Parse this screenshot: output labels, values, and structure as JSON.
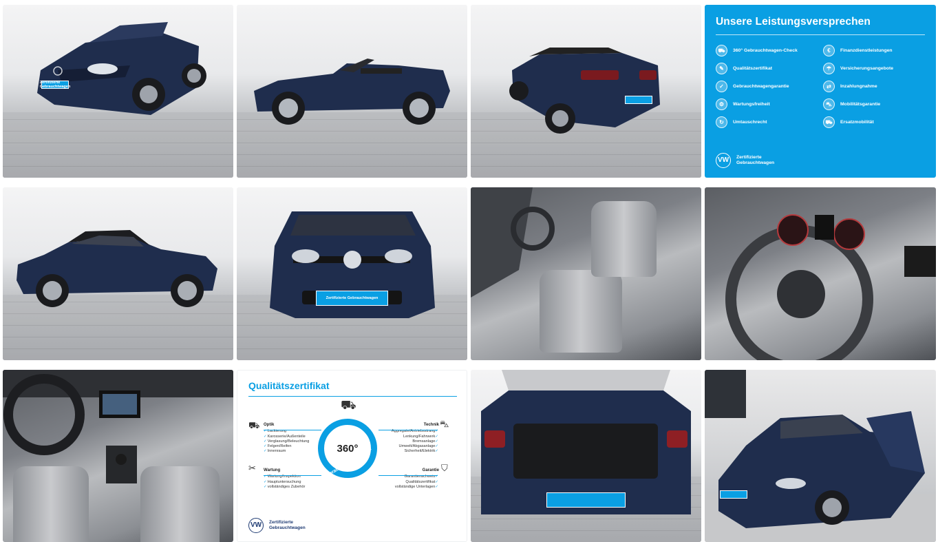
{
  "gallery": {
    "photos": [
      {
        "view": "front-left exterior, convertible top open",
        "plate": "Zertifizierte Gebrauchtwagen"
      },
      {
        "view": "side profile, top open"
      },
      {
        "view": "rear-right exterior, top open"
      },
      {
        "view": "side profile, top closed"
      },
      {
        "view": "front exterior",
        "plate": "Zertifizierte Gebrauchtwagen"
      },
      {
        "view": "interior front seats"
      },
      {
        "view": "steering wheel and cluster"
      },
      {
        "view": "dashboard and center console"
      },
      {
        "view": "open trunk"
      },
      {
        "view": "showroom front-left, door open"
      }
    ]
  },
  "promise_panel": {
    "title": "Unsere Leistungsversprechen",
    "items": [
      {
        "label": "360° Gebrauchtwagen-Check",
        "icon": "car-check-icon"
      },
      {
        "label": "Finanzdienstleistungen",
        "icon": "finance-icon"
      },
      {
        "label": "Qualitätszertifikat",
        "icon": "certificate-icon"
      },
      {
        "label": "Versicherungsangebote",
        "icon": "insurance-icon"
      },
      {
        "label": "Gebrauchtwagengarantie",
        "icon": "warranty-icon"
      },
      {
        "label": "Inzahlungnahme",
        "icon": "trade-in-icon"
      },
      {
        "label": "Wartungsfreiheit",
        "icon": "maintenance-icon"
      },
      {
        "label": "Mobilitätsgarantie",
        "icon": "mobility-icon"
      },
      {
        "label": "Umtauschrecht",
        "icon": "exchange-icon"
      },
      {
        "label": "Ersatzmobilität",
        "icon": "replacement-car-icon"
      }
    ],
    "footer": {
      "line1": "Zertifizierte",
      "line2": "Gebrauchtwagen",
      "logo": "VW"
    },
    "bg_color": "#0a9fe3"
  },
  "quality_panel": {
    "title": "Qualitätszertifikat",
    "center_number": "360°",
    "center_label": "Gebrauchtwagen-Check",
    "optik": {
      "head": "Optik",
      "items": [
        "Lackierung",
        "Karosserie/Außenteile",
        "Verglasung/Beleuchtung",
        "Felgen/Reifen",
        "Innenraum"
      ]
    },
    "technik": {
      "head": "Technik",
      "items": [
        "Aggregate/Antriebsstrang",
        "Lenkung/Fahrwerk",
        "Bremsanlage",
        "Umwelt/Abgasanlage",
        "Sicherheit/Elektrik"
      ]
    },
    "wartung": {
      "head": "Wartung",
      "items": [
        "Wartung/Inspektion",
        "Hauptuntersuchung",
        "vollständiges Zubehör"
      ]
    },
    "garantie": {
      "head": "Garantie",
      "items": [
        "Garantienachweis",
        "Qualitätszertifikat",
        "vollständige Unterlagen"
      ]
    },
    "footer": {
      "line1": "Zertifizierte",
      "line2": "Gebrauchtwagen",
      "logo": "VW"
    }
  },
  "colors": {
    "accent": "#0a9fe3",
    "car_body": "#1f2d4d"
  }
}
